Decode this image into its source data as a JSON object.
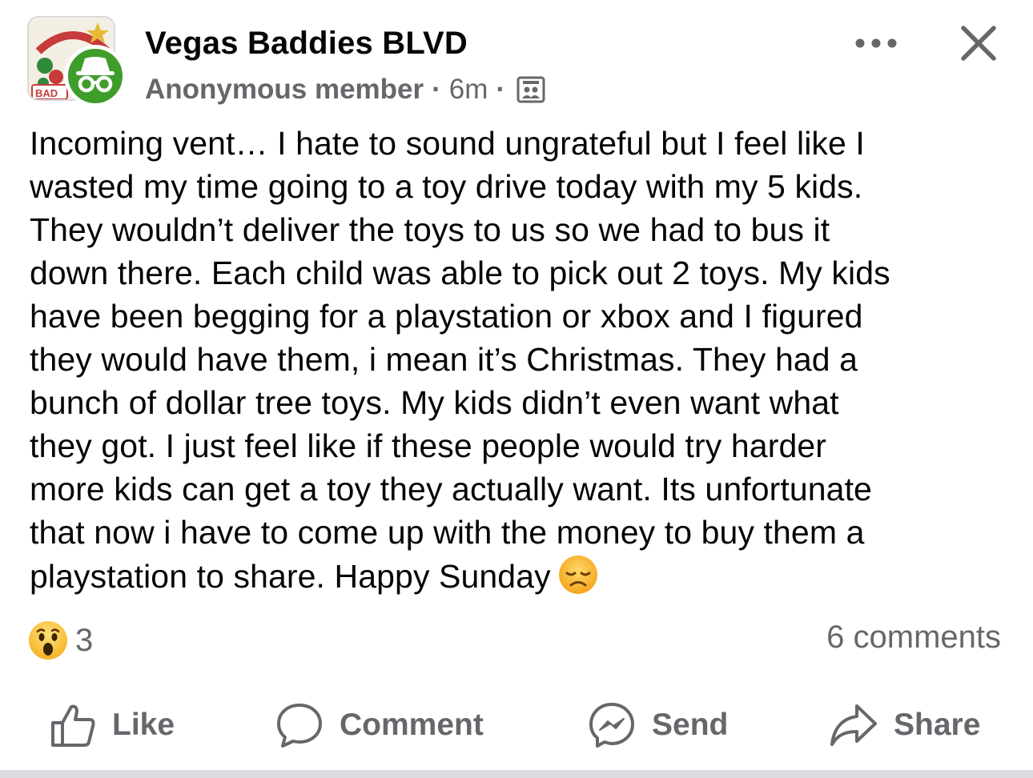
{
  "post": {
    "group_name": "Vegas Baddies BLVD",
    "group_avatar_icon": "group-logo-icon",
    "anon_badge_icon": "incognito-icon",
    "author": "Anonymous member",
    "separator": "·",
    "time": "6m",
    "privacy_icon": "members-group-icon",
    "more_icon": "more-options-icon",
    "close_icon": "close-icon",
    "body_lines": [
      "Incoming vent… I hate to sound ungrateful but I feel like I",
      "wasted my time going to a toy drive today with my 5 kids.",
      "They wouldn’t deliver the toys to us so we had to bus it",
      "down there. Each child was able to pick out 2 toys. My kids",
      "have been begging for a playstation or xbox and I figured",
      "they would have them, i mean it’s Christmas. They had a",
      "bunch of dollar tree toys. My kids didn’t even want what",
      "they got. I just feel like if these people would try harder",
      "more kids can get a toy they actually want. Its unfortunate",
      "that now i have to come up with the money to buy them a",
      "playstation to share. Happy Sunday"
    ],
    "trailing_emoji": "disappointed-face-emoji"
  },
  "engagement": {
    "reaction_icon": "wow-reaction-icon",
    "reaction_count": "3",
    "comments": "6 comments"
  },
  "actions": {
    "like": "Like",
    "comment": "Comment",
    "send": "Send",
    "share": "Share"
  },
  "colors": {
    "text_primary": "#050505",
    "text_secondary": "#65676b",
    "anon_badge": "#3f9d2b",
    "reaction_yellow": "#f7b125"
  }
}
